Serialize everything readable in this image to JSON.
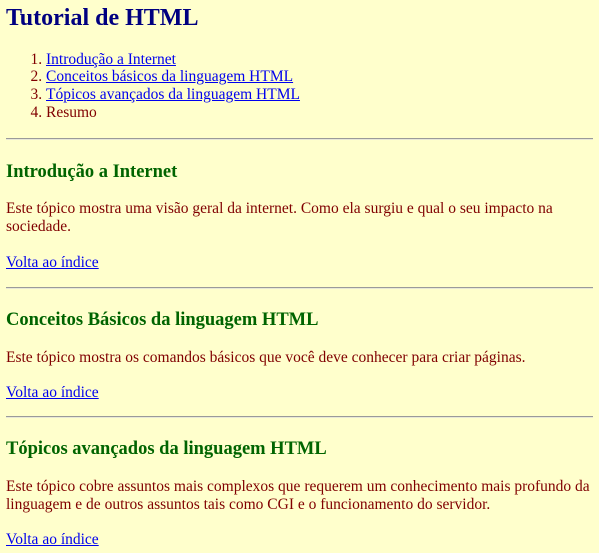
{
  "page": {
    "title": "Tutorial de HTML"
  },
  "index": {
    "items": [
      {
        "label": "Introdução a Internet",
        "link": true
      },
      {
        "label": "Conceitos básicos da linguagem HTML",
        "link": true
      },
      {
        "label": "Tópicos avançados da linguagem HTML",
        "link": true
      },
      {
        "label": "Resumo",
        "link": false
      }
    ]
  },
  "sections": [
    {
      "heading": "Introdução a Internet",
      "text": "Este tópico mostra uma visão geral da internet. Como ela surgiu e qual o seu impacto na sociedade.",
      "back_label": "Volta ao índice"
    },
    {
      "heading": "Conceitos Básicos da linguagem HTML",
      "text": "Este tópico mostra os comandos básicos que você deve conhecer para criar páginas.",
      "back_label": "Volta ao índice"
    },
    {
      "heading": "Tópicos avançados da linguagem HTML",
      "text": "Este tópico cobre assuntos mais complexos que requerem um conhecimento mais profundo da linguagem e de outros assuntos tais como CGI e o funcionamento do servidor.",
      "back_label": "Volta ao índice"
    }
  ],
  "colors": {
    "background": "#ffffcc",
    "title": "#000080",
    "heading": "#006400",
    "text": "#800000",
    "link": "#0000ee"
  }
}
